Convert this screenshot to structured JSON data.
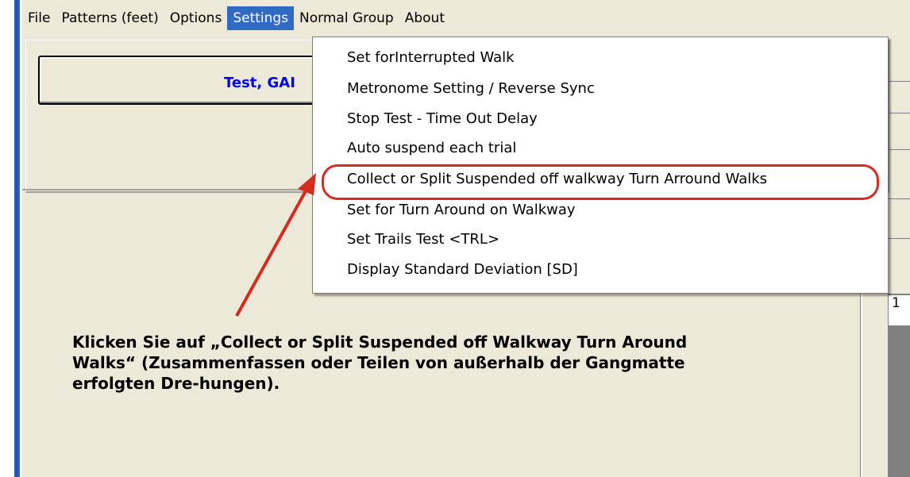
{
  "menubar": {
    "items": [
      "File",
      "Patterns (feet)",
      "Options",
      "Settings",
      "Normal Group",
      "About"
    ],
    "active": "Settings"
  },
  "header": {
    "title": "Test, GAI"
  },
  "settings_menu": {
    "items": [
      "Set forInterrupted Walk",
      "Metronome Setting / Reverse Sync",
      "Stop Test - Time Out Delay",
      "Auto suspend each trial",
      "Collect or Split Suspended off walkway Turn Arround Walks",
      "Set for Turn Around on Walkway",
      "Set Trails Test <TRL>",
      "Display Standard Deviation [SD]"
    ],
    "highlighted_index": 4
  },
  "grid": {
    "cell_value": "1"
  },
  "annotation": {
    "text": "Klicken Sie auf „Collect or Split Suspended off Walkway Turn Around Walks“ (Zusammenfassen oder Teilen von außerhalb der Gangmatte erfolgten Dre-hungen).",
    "color": "#d62b1e"
  }
}
